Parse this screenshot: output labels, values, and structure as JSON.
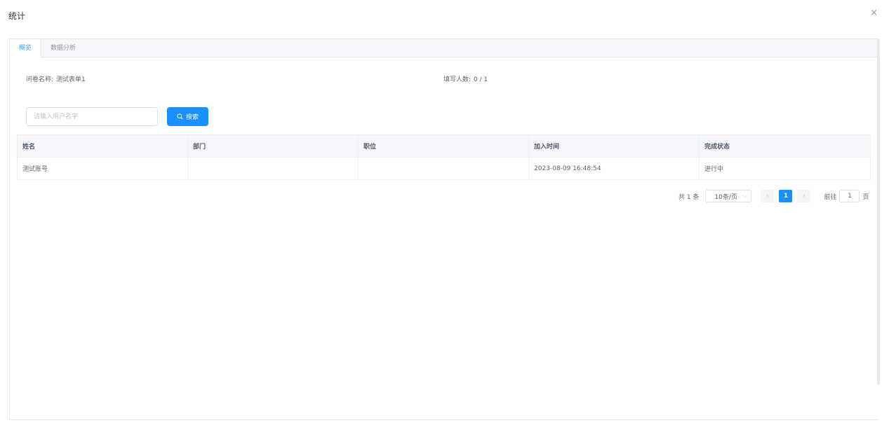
{
  "dialog": {
    "title": "统计",
    "close_symbol": "×"
  },
  "tabs": [
    {
      "label": "概览",
      "active": true
    },
    {
      "label": "数据分析",
      "active": false
    }
  ],
  "info": {
    "survey_label": "问卷名称:",
    "survey_name": "测试表单1",
    "count_label": "填写人数:",
    "count_value": "0 / 1"
  },
  "search": {
    "placeholder": "请输入用户名字",
    "value": "",
    "button_label": "搜索"
  },
  "table": {
    "columns": [
      "姓名",
      "部门",
      "职位",
      "加入时间",
      "完成状态"
    ],
    "rows": [
      [
        "测试账号",
        "",
        "",
        "2023-08-09 16:48:54",
        "进行中"
      ]
    ]
  },
  "pagination": {
    "total_text": "共 1 条",
    "page_size": "10条/页",
    "prev_symbol": "‹",
    "next_symbol": "›",
    "current_page": "1",
    "goto_label": "前往",
    "goto_value": "1",
    "page_suffix": "页"
  },
  "colors": {
    "accent": "#1890ff",
    "tab_active": "#409eff",
    "border": "#ebeef5"
  }
}
